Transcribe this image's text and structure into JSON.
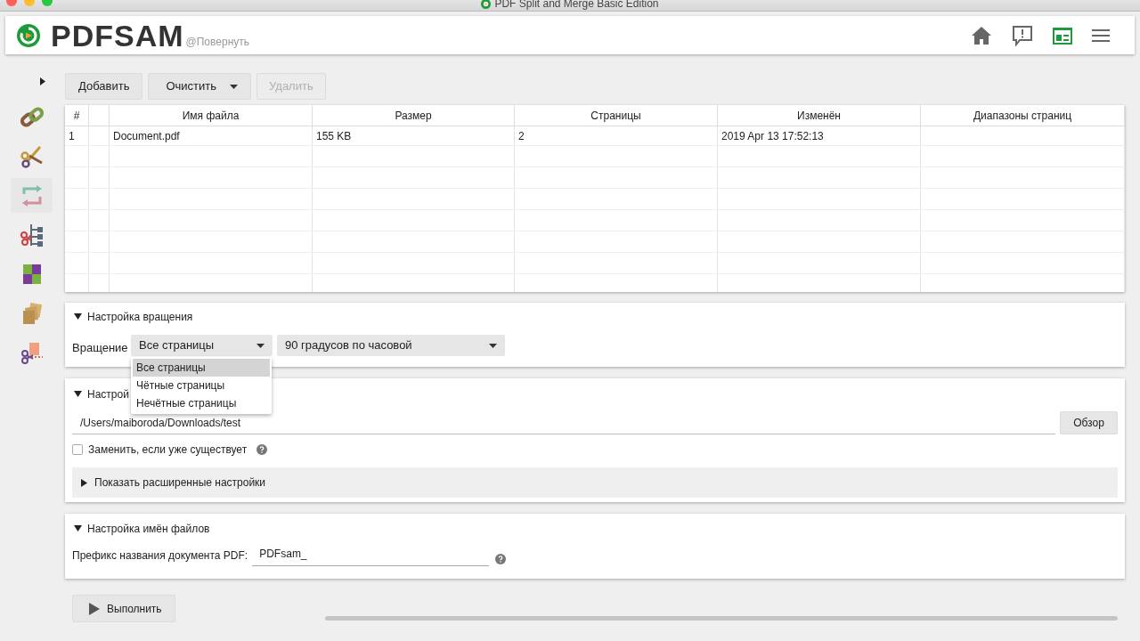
{
  "window": {
    "title": "PDF Split and Merge Basic Edition"
  },
  "header": {
    "logo_text": "PDFSAM",
    "subtitle": "@Повернуть",
    "buttons": [
      {
        "kind": "home",
        "selected": false
      },
      {
        "kind": "feedback",
        "selected": false
      },
      {
        "kind": "news",
        "selected": true
      },
      {
        "kind": "menu",
        "selected": false
      }
    ]
  },
  "sidebar": {
    "expanded": false,
    "items": [
      {
        "kind": "merge",
        "selected": false
      },
      {
        "kind": "split",
        "selected": false
      },
      {
        "kind": "rotate",
        "selected": true
      },
      {
        "kind": "split_bookmarks",
        "selected": false
      },
      {
        "kind": "alternate_mix",
        "selected": false
      },
      {
        "kind": "extract",
        "selected": false
      },
      {
        "kind": "split_size",
        "selected": false
      }
    ]
  },
  "toolbar": [
    {
      "label": "Добавить",
      "kind": "button",
      "disabled": false
    },
    {
      "label": "Очистить",
      "kind": "split",
      "disabled": false
    },
    {
      "label": "Удалить",
      "kind": "button",
      "disabled": true
    }
  ],
  "table": {
    "columns": [
      {
        "label": "#"
      },
      {},
      {
        "label": "Имя файла"
      },
      {
        "label": "Размер"
      },
      {
        "label": "Страницы"
      },
      {
        "label": "Изменён"
      },
      {
        "label": "Диапазоны страниц"
      }
    ],
    "rows": [
      {
        "cells": [
          "1",
          "",
          "Document.pdf",
          "155 KB",
          "2",
          "2019 Apr 13 17:52:13",
          ""
        ]
      }
    ]
  },
  "rotation_section": {
    "title": "Настройка вращения",
    "expanded": true,
    "label": "Вращение",
    "pages_select": {
      "value": "Все страницы",
      "open": true,
      "options": [
        {
          "label": "Все страницы",
          "selected": true
        },
        {
          "label": "Чётные страницы",
          "selected": false
        },
        {
          "label": "Нечётные страницы",
          "selected": false
        }
      ]
    },
    "angle_select": {
      "value": "90 градусов по часовой"
    }
  },
  "destination_section": {
    "title": "Настрой",
    "expanded": true,
    "path": "/Users/maiboroda/Downloads/test",
    "browse_button": "Обзор",
    "overwrite": {
      "label": "Заменить, если уже существует",
      "checked": false
    },
    "advanced": {
      "label": "Показать расширенные настройки",
      "expanded": false
    }
  },
  "filenames_section": {
    "title": "Настройка имён файлов",
    "expanded": true,
    "label": "Префикс названия документа PDF:",
    "prefix": "PDFsam_"
  },
  "run_button": "Выполнить"
}
